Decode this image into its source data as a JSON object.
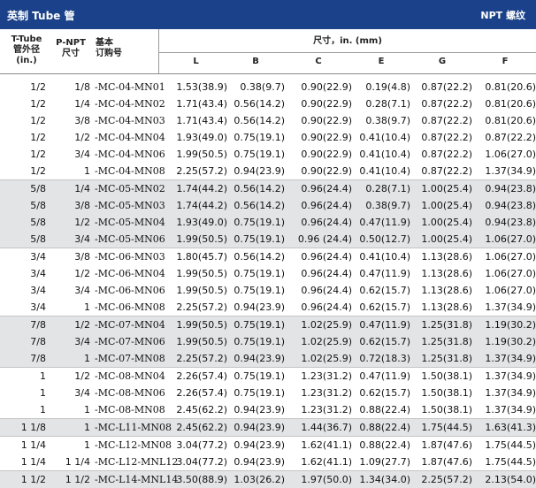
{
  "title": {
    "left": "英制 Tube 管",
    "right": "NPT 螺纹"
  },
  "headers": {
    "tube_od": "T-Tube\n管外径\n(in.)",
    "pnpt": "P-NPT\n尺寸",
    "part": "基本\n订购号",
    "dims_title": "尺寸，in. (mm)",
    "dims": [
      "L",
      "B",
      "C",
      "E",
      "G",
      "F"
    ]
  },
  "groups": [
    {
      "shaded": false,
      "rows": [
        [
          "1/2",
          "1/8",
          "-MC-04-MN01",
          "1.53(38.9)",
          "0.38(9.7)",
          "0.90(22.9)",
          "0.19(4.8)",
          "0.87(22.2)",
          "0.81(20.6)"
        ],
        [
          "1/2",
          "1/4",
          "-MC-04-MN02",
          "1.71(43.4)",
          "0.56(14.2)",
          "0.90(22.9)",
          "0.28(7.1)",
          "0.87(22.2)",
          "0.81(20.6)"
        ],
        [
          "1/2",
          "3/8",
          "-MC-04-MN03",
          "1.71(43.4)",
          "0.56(14.2)",
          "0.90(22.9)",
          "0.38(9.7)",
          "0.87(22.2)",
          "0.81(20.6)"
        ],
        [
          "1/2",
          "1/2",
          "-MC-04-MN04",
          "1.93(49.0)",
          "0.75(19.1)",
          "0.90(22.9)",
          "0.41(10.4)",
          "0.87(22.2)",
          "0.87(22.2)"
        ],
        [
          "1/2",
          "3/4",
          "-MC-04-MN06",
          "1.99(50.5)",
          "0.75(19.1)",
          "0.90(22.9)",
          "0.41(10.4)",
          "0.87(22.2)",
          "1.06(27.0)"
        ],
        [
          "1/2",
          "1",
          "-MC-04-MN08",
          "2.25(57.2)",
          "0.94(23.9)",
          "0.90(22.9)",
          "0.41(10.4)",
          "0.87(22.2)",
          "1.37(34.9)"
        ]
      ]
    },
    {
      "shaded": true,
      "rows": [
        [
          "5/8",
          "1/4",
          "-MC-05-MN02",
          "1.74(44.2)",
          "0.56(14.2)",
          "0.96(24.4)",
          "0.28(7.1)",
          "1.00(25.4)",
          "0.94(23.8)"
        ],
        [
          "5/8",
          "3/8",
          "-MC-05-MN03",
          "1.74(44.2)",
          "0.56(14.2)",
          "0.96(24.4)",
          "0.38(9.7)",
          "1.00(25.4)",
          "0.94(23.8)"
        ],
        [
          "5/8",
          "1/2",
          "-MC-05-MN04",
          "1.93(49.0)",
          "0.75(19.1)",
          "0.96(24.4)",
          "0.47(11.9)",
          "1.00(25.4)",
          "0.94(23.8)"
        ],
        [
          "5/8",
          "3/4",
          "-MC-05-MN06",
          "1.99(50.5)",
          "0.75(19.1)",
          "0.96 (24.4)",
          "0.50(12.7)",
          "1.00(25.4)",
          "1.06(27.0)"
        ]
      ]
    },
    {
      "shaded": false,
      "rows": [
        [
          "3/4",
          "3/8",
          "-MC-06-MN03",
          "1.80(45.7)",
          "0.56(14.2)",
          "0.96(24.4)",
          "0.41(10.4)",
          "1.13(28.6)",
          "1.06(27.0)"
        ],
        [
          "3/4",
          "1/2",
          "-MC-06-MN04",
          "1.99(50.5)",
          "0.75(19.1)",
          "0.96(24.4)",
          "0.47(11.9)",
          "1.13(28.6)",
          "1.06(27.0)"
        ],
        [
          "3/4",
          "3/4",
          "-MC-06-MN06",
          "1.99(50.5)",
          "0.75(19.1)",
          "0.96(24.4)",
          "0.62(15.7)",
          "1.13(28.6)",
          "1.06(27.0)"
        ],
        [
          "3/4",
          "1",
          "-MC-06-MN08",
          "2.25(57.2)",
          "0.94(23.9)",
          "0.96(24.4)",
          "0.62(15.7)",
          "1.13(28.6)",
          "1.37(34.9)"
        ]
      ]
    },
    {
      "shaded": true,
      "rows": [
        [
          "7/8",
          "1/2",
          "-MC-07-MN04",
          "1.99(50.5)",
          "0.75(19.1)",
          "1.02(25.9)",
          "0.47(11.9)",
          "1.25(31.8)",
          "1.19(30.2)"
        ],
        [
          "7/8",
          "3/4",
          "-MC-07-MN06",
          "1.99(50.5)",
          "0.75(19.1)",
          "1.02(25.9)",
          "0.62(15.7)",
          "1.25(31.8)",
          "1.19(30.2)"
        ],
        [
          "7/8",
          "1",
          "-MC-07-MN08",
          "2.25(57.2)",
          "0.94(23.9)",
          "1.02(25.9)",
          "0.72(18.3)",
          "1.25(31.8)",
          "1.37(34.9)"
        ]
      ]
    },
    {
      "shaded": false,
      "rows": [
        [
          "1",
          "1/2",
          "-MC-08-MN04",
          "2.26(57.4)",
          "0.75(19.1)",
          "1.23(31.2)",
          "0.47(11.9)",
          "1.50(38.1)",
          "1.37(34.9)"
        ],
        [
          "1",
          "3/4",
          "-MC-08-MN06",
          "2.26(57.4)",
          "0.75(19.1)",
          "1.23(31.2)",
          "0.62(15.7)",
          "1.50(38.1)",
          "1.37(34.9)"
        ],
        [
          "1",
          "1",
          "-MC-08-MN08",
          "2.45(62.2)",
          "0.94(23.9)",
          "1.23(31.2)",
          "0.88(22.4)",
          "1.50(38.1)",
          "1.37(34.9)"
        ]
      ]
    },
    {
      "shaded": true,
      "rows": [
        [
          "1 1/8",
          "1",
          "-MC-L11-MN08",
          "2.45(62.2)",
          "0.94(23.9)",
          "1.44(36.7)",
          "0.88(22.4)",
          "1.75(44.5)",
          "1.63(41.3)"
        ]
      ]
    },
    {
      "shaded": false,
      "rows": [
        [
          "1 1/4",
          "1",
          "-MC-L12-MN08",
          "3.04(77.2)",
          "0.94(23.9)",
          "1.62(41.1)",
          "0.88(22.4)",
          "1.87(47.6)",
          "1.75(44.5)"
        ],
        [
          "1 1/4",
          "1 1/4",
          "-MC-L12-MNL12",
          "3.04(77.2)",
          "0.94(23.9)",
          "1.62(41.1)",
          "1.09(27.7)",
          "1.87(47.6)",
          "1.75(44.5)"
        ]
      ]
    },
    {
      "shaded": true,
      "rows": [
        [
          "1 1/2",
          "1 1/2",
          "-MC-L14-MNL14",
          "3.50(88.9)",
          "1.03(26.2)",
          "1.97(50.0)",
          "1.34(34.0)",
          "2.25(57.2)",
          "2.13(54.0)"
        ]
      ]
    }
  ]
}
